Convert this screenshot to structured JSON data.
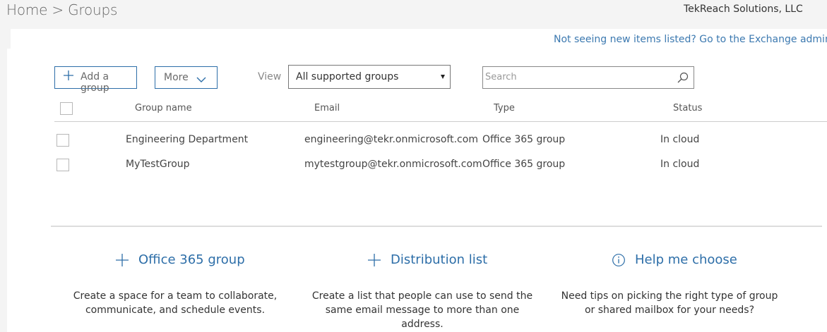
{
  "header": {
    "breadcrumb": "Home > Groups",
    "org_name": "TekReach Solutions, LLC"
  },
  "notice": {
    "text": "Not seeing new items listed? Go to the Exchange admin cent"
  },
  "toolbar": {
    "add_label": "Add a group",
    "more_label": "More",
    "view_label": "View",
    "view_selected": "All supported groups",
    "search_placeholder": "Search"
  },
  "table": {
    "headers": {
      "name": "Group name",
      "email": "Email",
      "type": "Type",
      "status": "Status"
    },
    "rows": [
      {
        "name": "Engineering Department",
        "email": "engineering@tekr.onmicrosoft.com",
        "type": "Office 365 group",
        "status": "In cloud"
      },
      {
        "name": "MyTestGroup",
        "email": "mytestgroup@tekr.onmicrosoft.com",
        "type": "Office 365 group",
        "status": "In cloud"
      }
    ]
  },
  "options": [
    {
      "label": "Office 365 group",
      "icon": "plus-icon",
      "desc_lines": [
        "Create a space for a team to collaborate,",
        "communicate, and schedule events."
      ]
    },
    {
      "label": "Distribution list",
      "icon": "plus-icon",
      "desc_lines": [
        "Create a list that people can use to send the",
        "same email message to more than one",
        "address."
      ]
    },
    {
      "label": "Help me choose",
      "icon": "info-icon",
      "desc_lines": [
        "Need tips on picking the right type of group",
        "or shared mailbox for your needs?"
      ]
    }
  ],
  "colors": {
    "accent": "#2d6ea8",
    "link": "#3c79b0",
    "background": "#f4f4f4"
  }
}
